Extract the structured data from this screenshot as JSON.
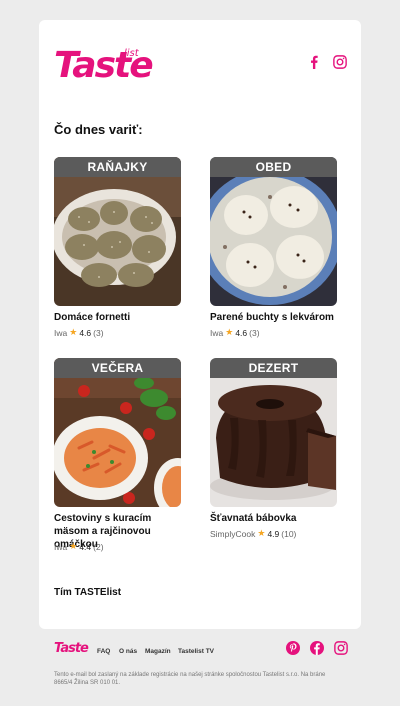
{
  "brand": {
    "logo_main": "Taste",
    "logo_sup": "list",
    "color": "#e5127d"
  },
  "header": {
    "social": [
      "facebook-icon",
      "instagram-icon"
    ]
  },
  "heading": "Čo dnes variť:",
  "recipes": [
    {
      "category": "RAŇAJKY",
      "title": "Domáce fornetti",
      "author": "Iwa",
      "rating": "4.6",
      "count": "(3)"
    },
    {
      "category": "OBED",
      "title": "Parené buchty s lekvárom",
      "author": "Iwa",
      "rating": "4.6",
      "count": "(3)"
    },
    {
      "category": "VEČERA",
      "title": "Cestoviny s kuracím mäsom a rajčinovou omáčkou",
      "author": "Iwa",
      "rating": "4.4",
      "count": "(2)"
    },
    {
      "category": "DEZERT",
      "title": "Šťavnatá bábovka",
      "author": "SimplyCook",
      "rating": "4.9",
      "count": "(10)"
    }
  ],
  "signature": "Tím TASTElist",
  "footer": {
    "logo": "Taste",
    "links": [
      "FAQ",
      "O nás",
      "Magazín",
      "Tastelist TV"
    ],
    "social": [
      "pinterest-icon",
      "facebook-icon",
      "instagram-icon"
    ],
    "disclaimer": "Tento e-mail bol zaslaný na základe registrácie na našej stránke spoločnostou Tastelist s.r.o. Na bráne 8665/4 Žilina SR 010 01."
  }
}
